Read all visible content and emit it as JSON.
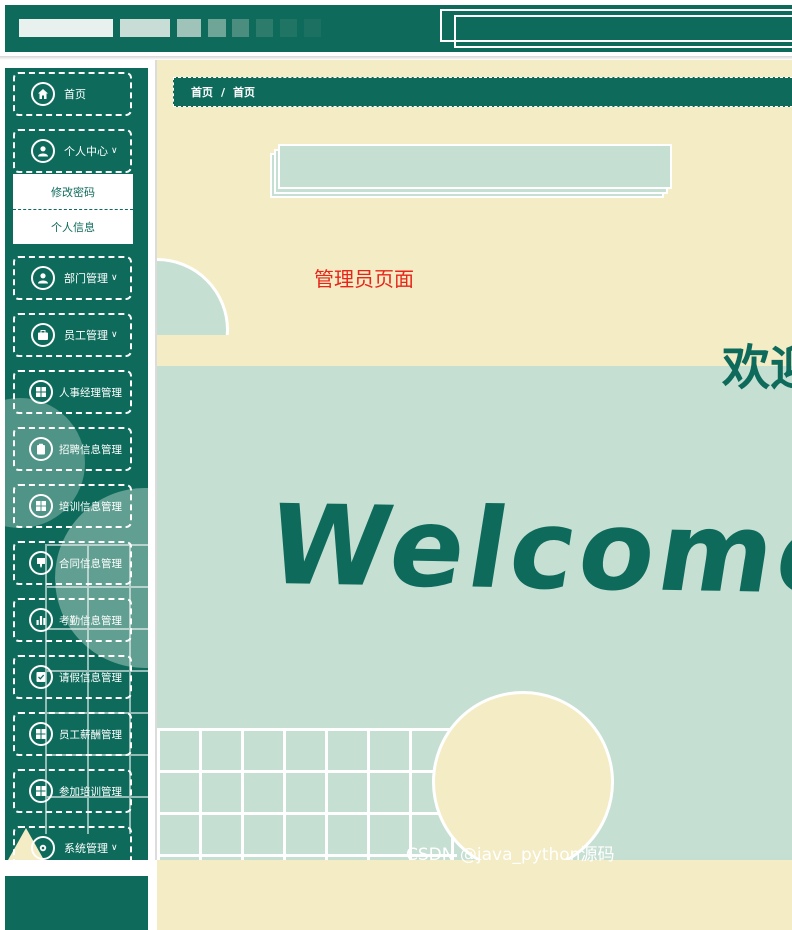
{
  "colors": {
    "primary": "#0e6b5c",
    "light_green": "#c6dfd3",
    "cream": "#f3ecc4",
    "accent_red": "#e8251b",
    "white": "#ffffff"
  },
  "sidebar": {
    "items": [
      {
        "label": "首页",
        "icon": "home-icon"
      },
      {
        "label": "个人中心",
        "icon": "user-icon",
        "chevron": "∨"
      },
      {
        "label": "部门管理",
        "icon": "user-icon",
        "chevron": "∨"
      },
      {
        "label": "员工管理",
        "icon": "briefcase-icon",
        "chevron": "∨"
      },
      {
        "label": "人事经理管理",
        "icon": "grid-icon"
      },
      {
        "label": "招聘信息管理",
        "icon": "clipboard-icon"
      },
      {
        "label": "培训信息管理",
        "icon": "grid-icon"
      },
      {
        "label": "合同信息管理",
        "icon": "contract-icon"
      },
      {
        "label": "考勤信息管理",
        "icon": "bar-chart-icon"
      },
      {
        "label": "请假信息管理",
        "icon": "check-doc-icon"
      },
      {
        "label": "员工薪酬管理",
        "icon": "grid-icon"
      },
      {
        "label": "参加培训管理",
        "icon": "grid-icon"
      },
      {
        "label": "系统管理",
        "icon": "settings-icon",
        "chevron": "∨"
      }
    ],
    "submenu": [
      {
        "label": "修改密码"
      },
      {
        "label": "个人信息"
      }
    ]
  },
  "breadcrumb": {
    "items": [
      "首页",
      "首页"
    ],
    "separator": "/"
  },
  "main": {
    "admin_page_label": "管理员页面",
    "welcome_cn": "欢迎",
    "welcome_en": "Welcome"
  },
  "watermark": "CSDN @java_python源码"
}
